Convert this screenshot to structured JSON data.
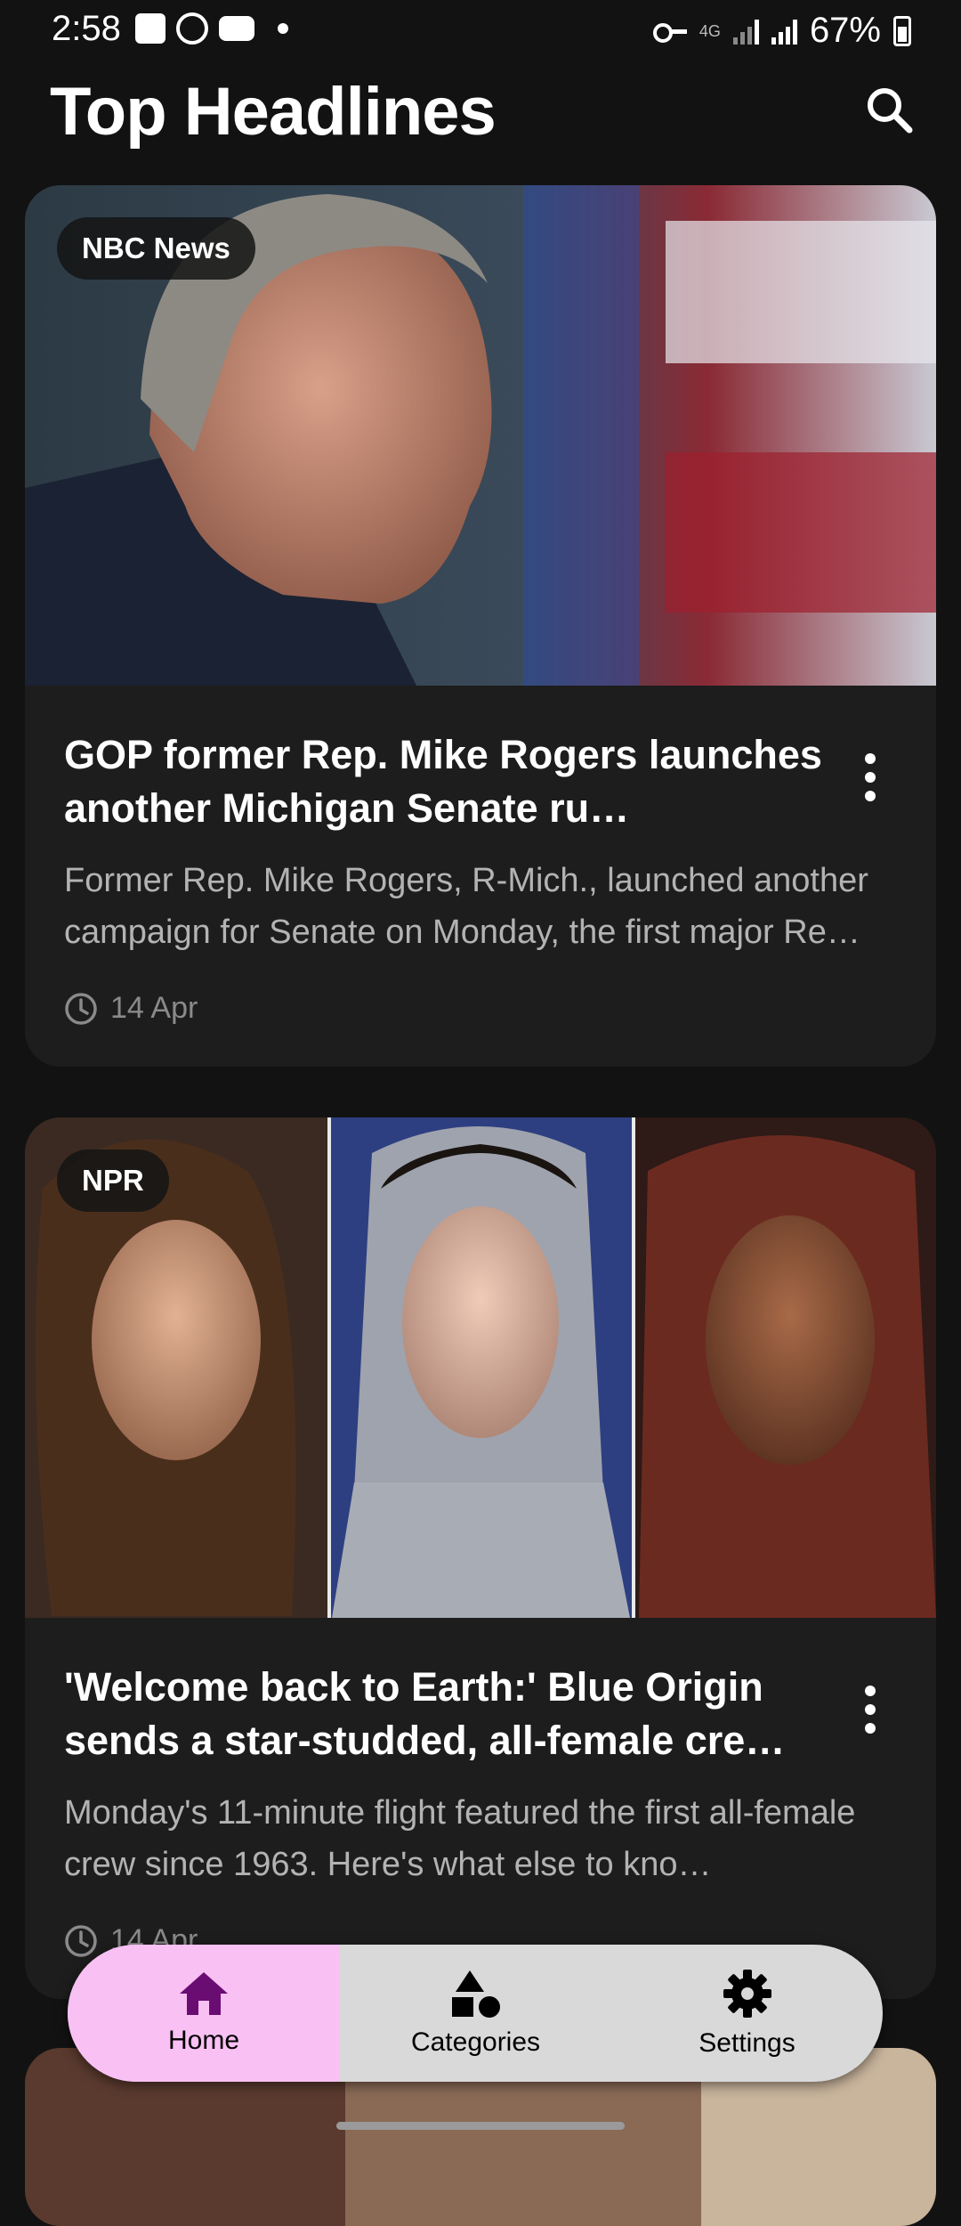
{
  "status_bar": {
    "time": "2:58",
    "network": "4G",
    "battery": "67%"
  },
  "header": {
    "title": "Top Headlines"
  },
  "articles": [
    {
      "source": "NBC News",
      "title": "GOP former Rep. Mike Rogers launches another Michigan Senate ru…",
      "description": "Former Rep. Mike Rogers, R-Mich., launched another campaign for Senate on Monday, the first major Re…",
      "date": "14 Apr"
    },
    {
      "source": "NPR",
      "title": "'Welcome back to Earth:' Blue Origin sends a star-studded, all-female cre…",
      "description": "Monday's 11-minute flight featured the first all-female crew since 1963. Here's what else to kno…",
      "date": "14 Apr"
    }
  ],
  "bottom_nav": {
    "items": [
      {
        "label": "Home",
        "icon": "home-icon",
        "active": true
      },
      {
        "label": "Categories",
        "icon": "categories-icon",
        "active": false
      },
      {
        "label": "Settings",
        "icon": "gear-icon",
        "active": false
      }
    ]
  },
  "colors": {
    "background": "#121212",
    "card": "#1d1d1d",
    "nav_active": "#f9c0f4",
    "nav_bg": "#d9d9d9",
    "accent": "#6a0d73"
  }
}
